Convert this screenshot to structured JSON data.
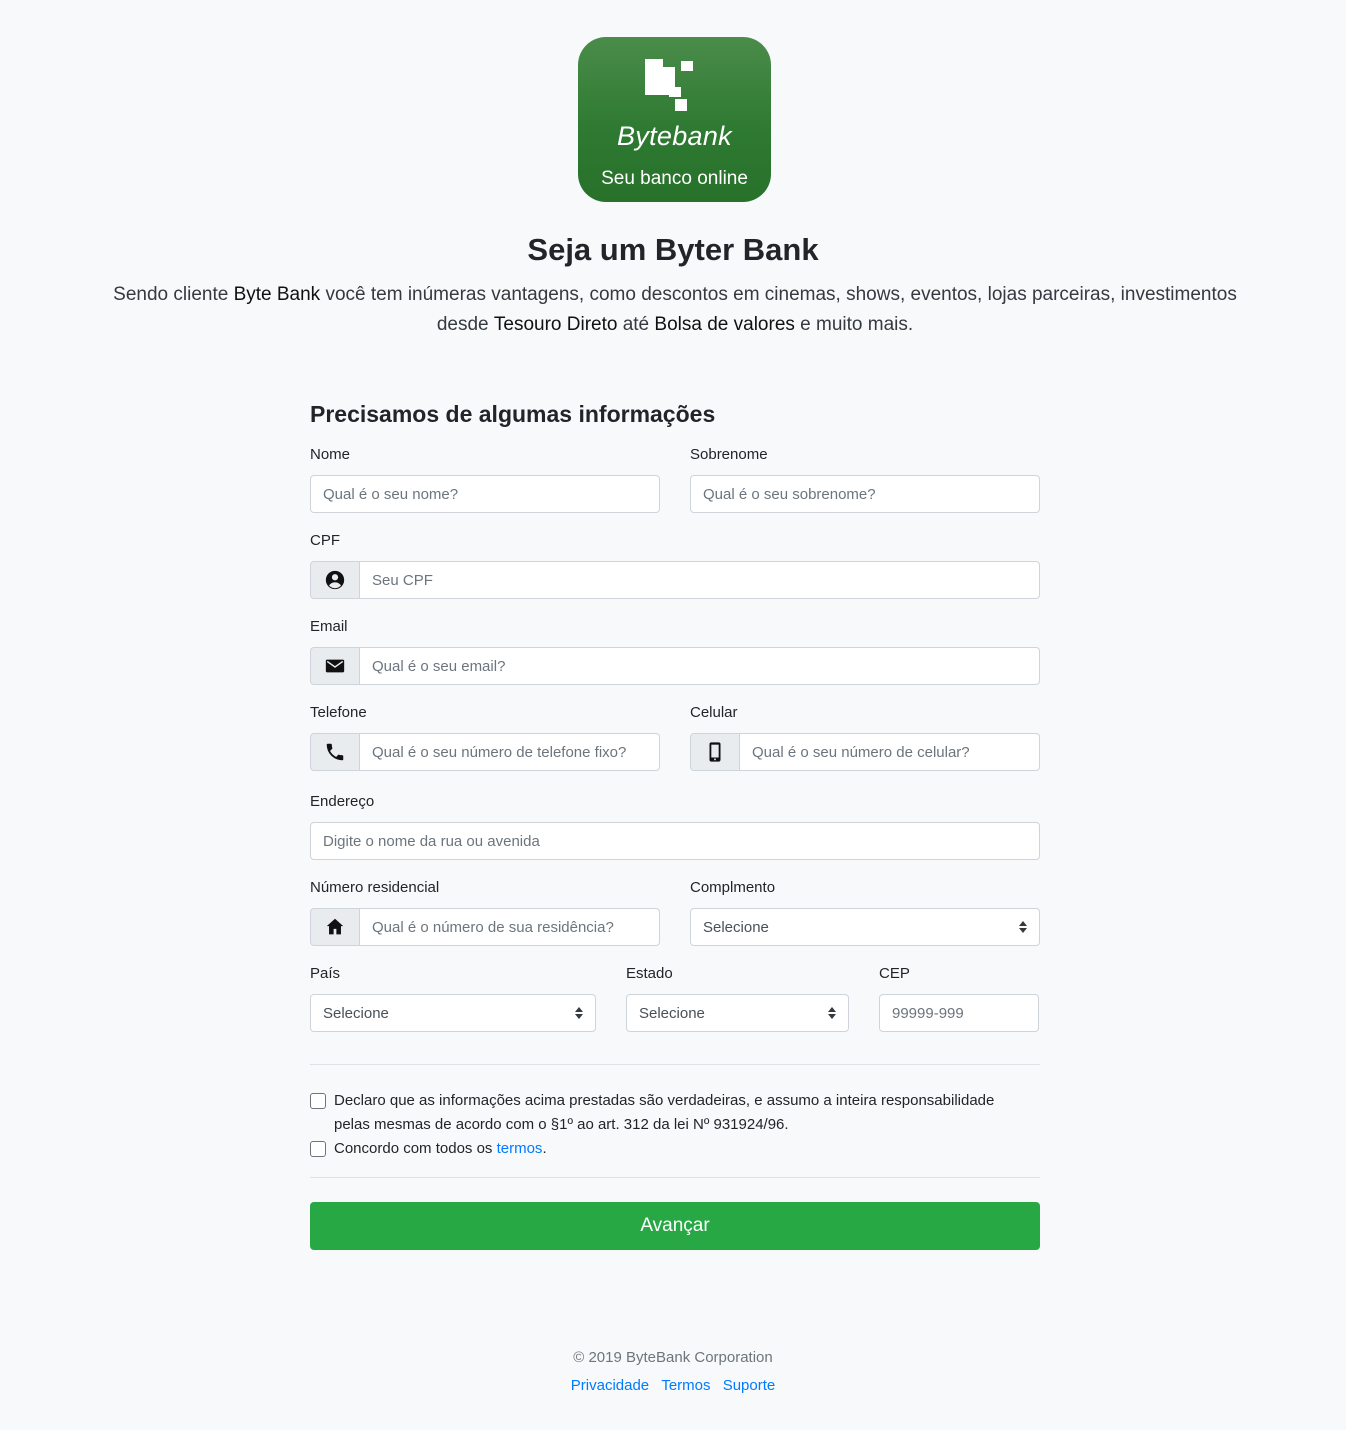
{
  "logo": {
    "name": "Bytebank",
    "tagline": "Seu banco online"
  },
  "hero": {
    "title": "Seja um Byter Bank",
    "lead_1": "Sendo cliente ",
    "lead_brand": "Byte Bank",
    "lead_2": " você tem inúmeras vantagens, como descontos em cinemas, shows, eventos, lojas parceiras, investimentos desde ",
    "lead_b2": "Tesouro Direto",
    "lead_3": " até ",
    "lead_b3": "Bolsa de valores",
    "lead_4": " e muito mais."
  },
  "form": {
    "title": "Precisamos de algumas informações",
    "nome": {
      "label": "Nome",
      "placeholder": "Qual é o seu nome?"
    },
    "sobrenome": {
      "label": "Sobrenome",
      "placeholder": "Qual é o seu sobrenome?"
    },
    "cpf": {
      "label": "CPF",
      "placeholder": "Seu CPF"
    },
    "email": {
      "label": "Email",
      "placeholder": "Qual é o seu email?"
    },
    "telefone": {
      "label": "Telefone",
      "placeholder": "Qual é o seu número de telefone fixo?"
    },
    "celular": {
      "label": "Celular",
      "placeholder": "Qual é o seu número de celular?"
    },
    "endereco": {
      "label": "Endereço",
      "placeholder": "Digite o nome da rua ou avenida"
    },
    "numero": {
      "label": "Número residencial",
      "placeholder": "Qual é o número de sua residência?"
    },
    "complemento": {
      "label": "Complmento",
      "value": "Selecione"
    },
    "pais": {
      "label": "País",
      "value": "Selecione"
    },
    "estado": {
      "label": "Estado",
      "value": "Selecione"
    },
    "cep": {
      "label": "CEP",
      "placeholder": "99999-999"
    },
    "declaro": "Declaro que as informações acima prestadas são verdadeiras, e assumo a inteira responsabilidade pelas mesmas de acordo com o §1º ao art. 312 da lei Nº 931924/96.",
    "concordo_text": "Concordo com todos os ",
    "concordo_link": "termos",
    "concordo_end": ".",
    "submit": "Avançar"
  },
  "footer": {
    "copyright": "© 2019 ByteBank Corporation",
    "links": [
      "Privacidade",
      "Termos",
      "Suporte"
    ]
  },
  "colors": {
    "primary_green": "#28a745",
    "logo_green": "#2f7a32",
    "link": "#007bff"
  }
}
